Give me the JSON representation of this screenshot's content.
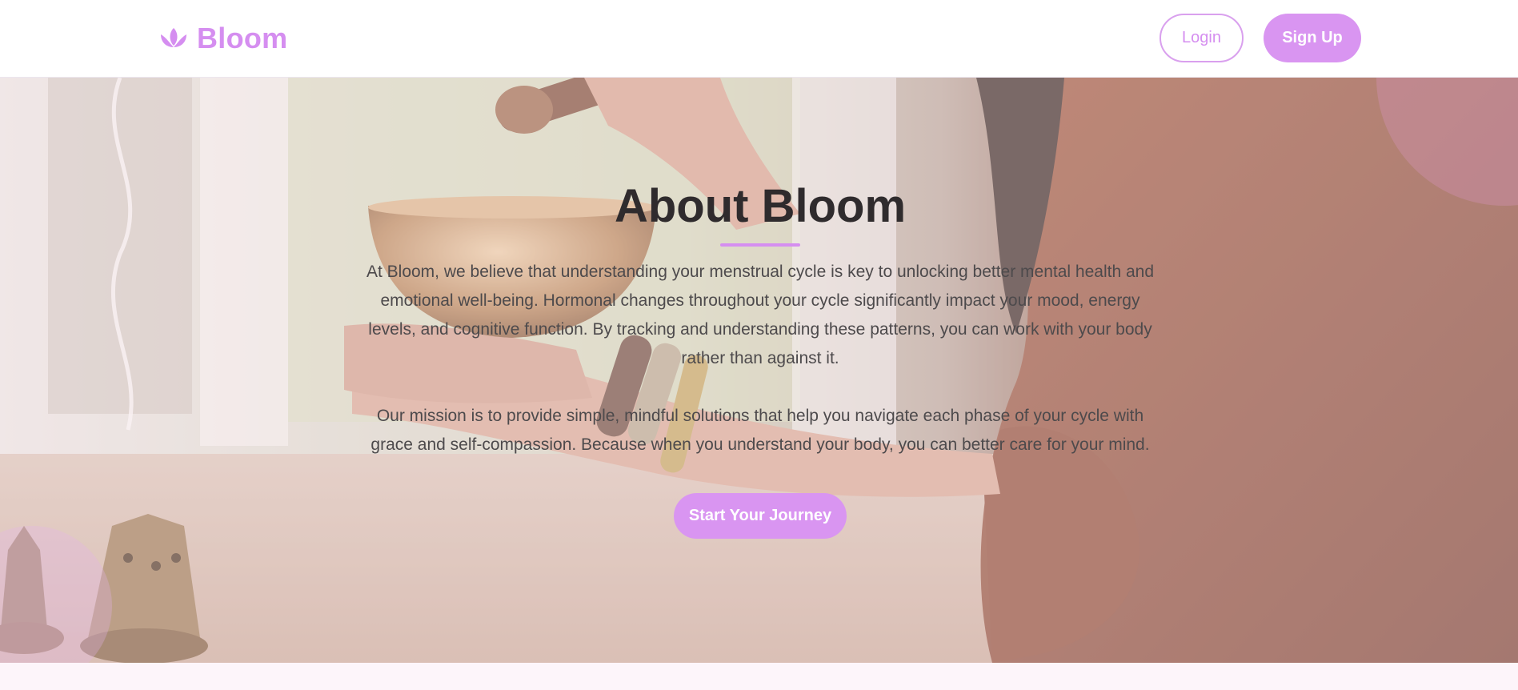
{
  "header": {
    "brand_name": "Bloom",
    "brand_icon": "lotus-icon",
    "login_label": "Login",
    "signup_label": "Sign Up"
  },
  "hero": {
    "title": "About Bloom",
    "paragraph_1": "At Bloom, we believe that understanding your menstrual cycle is key to unlocking better mental health and emotional well-being. Hormonal changes throughout your cycle significantly impact your mood, energy levels, and cognitive function. By tracking and understanding these patterns, you can work with your body rather than against it.",
    "paragraph_2": "Our mission is to provide simple, mindful solutions that help you navigate each phase of your cycle with grace and self-compassion. Because when you understand your body, you can better care for your mind.",
    "cta_label": "Start Your Journey",
    "background_image": "woman-holding-singing-bowl-photo"
  },
  "colors": {
    "accent": "#d995f1",
    "brand_text": "#d58ef0",
    "title_text": "#2f2b2d",
    "body_text": "#4d4a4c",
    "footer_band": "#fdf5fa"
  }
}
